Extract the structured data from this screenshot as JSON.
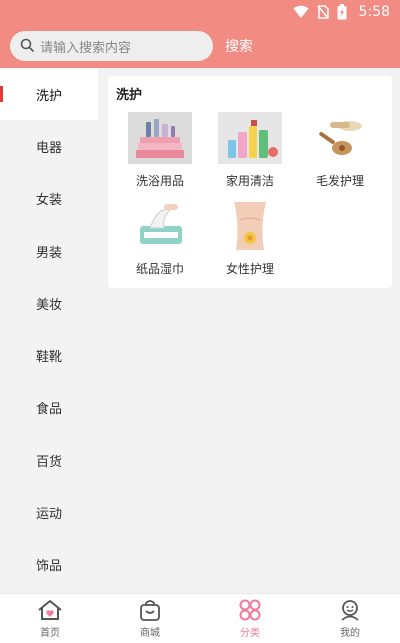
{
  "status_bar": {
    "time": "5:58"
  },
  "search": {
    "placeholder": "请输入搜索内容",
    "button_label": "搜索"
  },
  "sidebar": {
    "items": [
      {
        "label": "洗护",
        "active": true
      },
      {
        "label": "电器"
      },
      {
        "label": "女装"
      },
      {
        "label": "男装"
      },
      {
        "label": "美妆"
      },
      {
        "label": "鞋靴"
      },
      {
        "label": "食品"
      },
      {
        "label": "百货"
      },
      {
        "label": "运动"
      },
      {
        "label": "饰品"
      }
    ]
  },
  "content": {
    "section_title": "洗护",
    "items": [
      {
        "label": "洗浴用品",
        "icon": "towels-image"
      },
      {
        "label": "家用清洁",
        "icon": "cleaning-bottles-image"
      },
      {
        "label": "毛发护理",
        "icon": "hairbrush-image"
      },
      {
        "label": "纸品湿巾",
        "icon": "wet-wipes-image"
      },
      {
        "label": "女性护理",
        "icon": "feminine-care-image"
      }
    ]
  },
  "bottom_nav": {
    "items": [
      {
        "label": "首页",
        "icon": "home-icon"
      },
      {
        "label": "商城",
        "icon": "shop-bag-icon"
      },
      {
        "label": "分类",
        "icon": "category-icon",
        "active": true
      },
      {
        "label": "我的",
        "icon": "profile-icon"
      }
    ],
    "active_color": "#ef7c9a"
  },
  "colors": {
    "header": "#f28b82",
    "accent": "#e53935"
  }
}
